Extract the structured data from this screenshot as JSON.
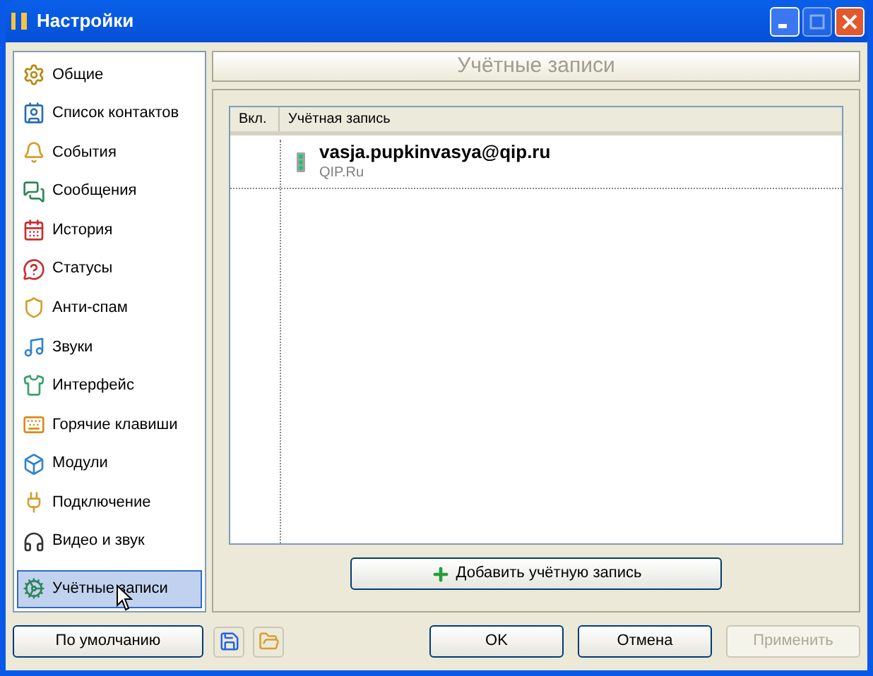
{
  "window": {
    "title": "Настройки",
    "title_buttons": [
      {
        "kind": "minimize",
        "disabled": false
      },
      {
        "kind": "maximize",
        "disabled": true
      },
      {
        "kind": "close",
        "disabled": false
      }
    ]
  },
  "sidebar": {
    "items": [
      {
        "label": "Общие",
        "selected": false
      },
      {
        "label": "Список контактов",
        "selected": false
      },
      {
        "label": "События",
        "selected": false
      },
      {
        "label": "Сообщения",
        "selected": false
      },
      {
        "label": "История",
        "selected": false
      },
      {
        "label": "Статусы",
        "selected": false
      },
      {
        "label": "Анти-спам",
        "selected": false
      },
      {
        "label": "Звуки",
        "selected": false
      },
      {
        "label": "Интерфейс",
        "selected": false
      },
      {
        "label": "Горячие клавиши",
        "selected": false
      },
      {
        "label": "Модули",
        "selected": false
      },
      {
        "label": "Подключение",
        "selected": false
      },
      {
        "label": "Видео и звук",
        "selected": false
      },
      {
        "label": "Учётные записи",
        "selected": true
      }
    ]
  },
  "panel": {
    "title": "Учётные записи",
    "table": {
      "columns": [
        "Вкл.",
        "Учётная запись"
      ],
      "rows": [
        {
          "account": "vasja.pupkinvasya@qip.ru",
          "network": "QIP.Ru"
        }
      ]
    },
    "add_button": "Добавить учётную запись"
  },
  "footer": {
    "defaults_button": "По умолчанию",
    "buttons": [
      {
        "label": "OK",
        "disabled": false
      },
      {
        "label": "Отмена",
        "disabled": false
      },
      {
        "label": "Применить",
        "disabled": true
      }
    ]
  }
}
